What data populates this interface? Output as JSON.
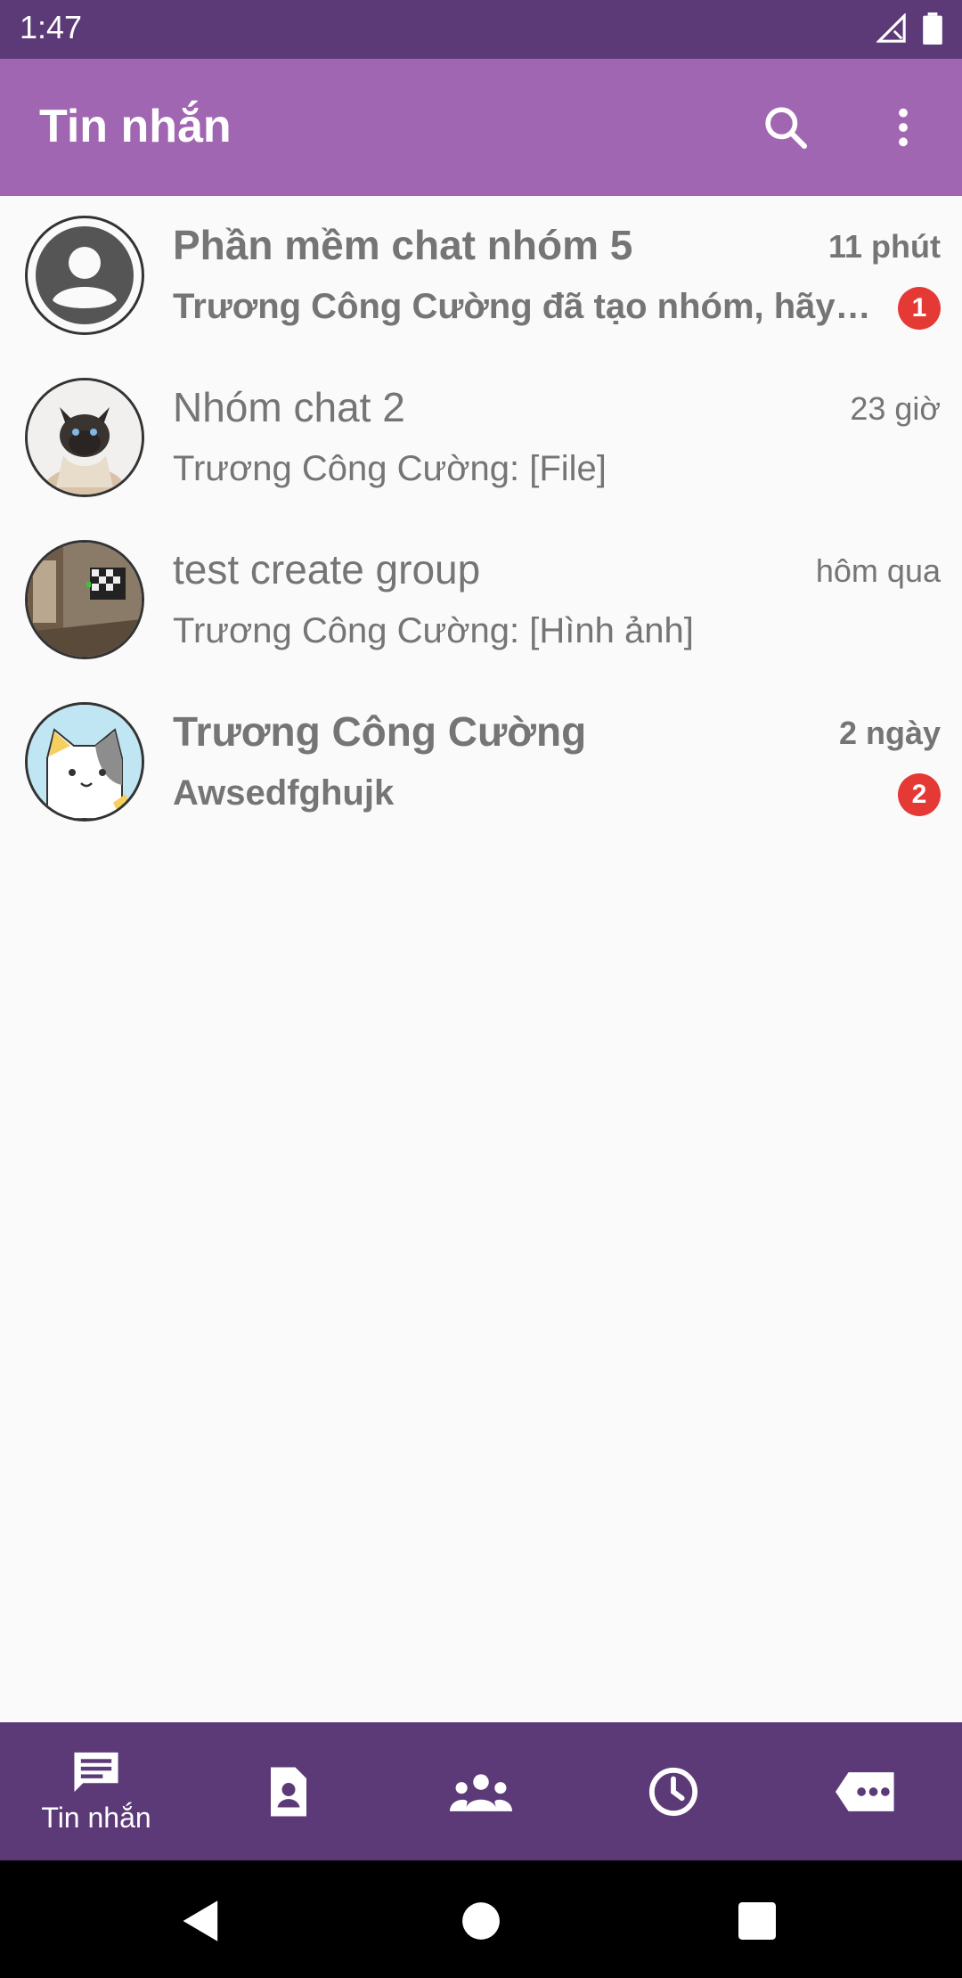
{
  "status_bar": {
    "time": "1:47"
  },
  "app_bar": {
    "title": "Tin nhắn",
    "icons": [
      "search-icon",
      "more-vert-icon"
    ]
  },
  "chats": [
    {
      "name": "Phần mềm chat nhóm 5",
      "time": "11 phút",
      "preview": "Trương Công Cường đã tạo nhóm, hãy cùng nhau trò chuyện",
      "badge": "1",
      "unread": true,
      "avatar": "default-user-avatar"
    },
    {
      "name": "Nhóm chat 2",
      "time": "23 giờ",
      "preview": "Trương Công Cường: [File]",
      "badge": "",
      "unread": false,
      "avatar": "cat-photo-avatar"
    },
    {
      "name": "test create group",
      "time": "hôm qua",
      "preview": "Trương Công Cường: [Hình ảnh]",
      "badge": "",
      "unread": false,
      "avatar": "room-photo-avatar"
    },
    {
      "name": "Trương Công Cường",
      "time": "2 ngày",
      "preview": "Awsedfghujk",
      "badge": "2",
      "unread": true,
      "avatar": "cartoon-cat-avatar"
    }
  ],
  "bottom_nav": {
    "active_label": "Tin nhắn",
    "items": [
      "chat-icon",
      "contact-icon",
      "group-icon",
      "history-icon",
      "more-chat-icon"
    ]
  },
  "colors": {
    "status_bar": "#5c3a77",
    "app_bar": "#a066b2",
    "bottom_nav": "#5c3a77",
    "badge": "#e53935",
    "text_secondary": "#757575"
  }
}
